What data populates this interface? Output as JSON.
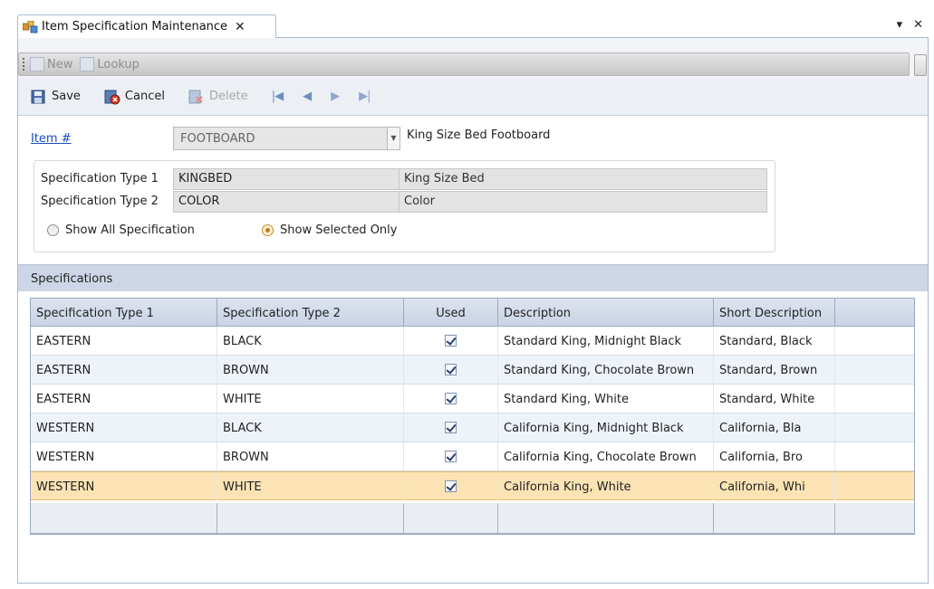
{
  "tab": {
    "title": "Item Specification Maintenance",
    "close": "✕"
  },
  "window_controls": {
    "pin": "▾",
    "close": "✕"
  },
  "toolstrip_top": {
    "new_label": "New",
    "lookup_label": "Lookup"
  },
  "toolbar": {
    "save_label": "Save",
    "cancel_label": "Cancel",
    "delete_label": "Delete",
    "nav": {
      "first": "|◀",
      "prev": "◀",
      "next": "▶",
      "last": "▶|"
    }
  },
  "item": {
    "label": "Item #",
    "value": "FOOTBOARD",
    "description": "King Size Bed Footboard"
  },
  "spec_filter": {
    "type1_label": "Specification Type 1",
    "type1_value": "KINGBED",
    "type1_desc": "King Size Bed",
    "type2_label": "Specification Type 2",
    "type2_value": "COLOR",
    "type2_desc": "Color",
    "show_all_label": "Show All Specification",
    "show_selected_label": "Show Selected Only"
  },
  "specifications": {
    "header": "Specifications",
    "columns": [
      "Specification Type 1",
      "Specification Type 2",
      "Used",
      "Description",
      "Short Description"
    ],
    "rows": [
      {
        "type1": "EASTERN",
        "type2": "BLACK",
        "used": true,
        "description": "Standard King, Midnight Black",
        "short": "Standard, Black"
      },
      {
        "type1": "EASTERN",
        "type2": "BROWN",
        "used": true,
        "description": "Standard King, Chocolate Brown",
        "short": "Standard, Brown"
      },
      {
        "type1": "EASTERN",
        "type2": "WHITE",
        "used": true,
        "description": "Standard King, White",
        "short": "Standard, White"
      },
      {
        "type1": "WESTERN",
        "type2": "BLACK",
        "used": true,
        "description": "California King, Midnight Black",
        "short": "California, Bla"
      },
      {
        "type1": "WESTERN",
        "type2": "BROWN",
        "used": true,
        "description": "California King, Chocolate Brown",
        "short": "California, Bro"
      },
      {
        "type1": "WESTERN",
        "type2": "WHITE",
        "used": true,
        "description": "California King, White",
        "short": "California, Whi"
      }
    ]
  },
  "colors": {
    "accent": "#1a4ebd",
    "selected_row": "#fbe3b4",
    "header_band": "#cdd6e6"
  }
}
